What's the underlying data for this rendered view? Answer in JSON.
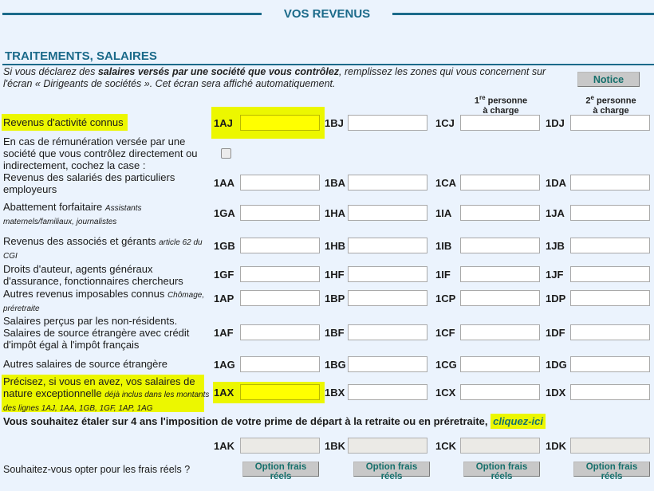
{
  "page": {
    "title": "VOS REVENUS",
    "section_title": "TRAITEMENTS, SALAIRES",
    "intro": {
      "part1": "Si vous déclarez des ",
      "bold": "salaires versés par une société que vous contrôlez",
      "part2": ", remplissez les zones qui vous concernent sur l'écran « Dirigeants de sociétés ». Cet écran sera affiché automatiquement."
    },
    "notice_button": "Notice",
    "colors": {
      "accent": "#1b6a8a",
      "highlight": "#ecf700",
      "button_text": "#16706c"
    }
  },
  "columns": {
    "col3_head": {
      "n": "1",
      "sup": "re",
      "rest": " personne",
      "line2": "à charge"
    },
    "col4_head": {
      "n": "2",
      "sup": "e",
      "rest": " personne",
      "line2": "à charge"
    }
  },
  "rows": [
    {
      "label": "Revenus d'activité connus",
      "hint": "",
      "codes": [
        "1AJ",
        "1BJ",
        "1CJ",
        "1DJ"
      ]
    },
    {
      "label": "En cas de rémunération versée par une société que vous contrôlez directement ou indirectement, cochez la case :",
      "checkbox_checked": false
    },
    {
      "label": "Revenus des salariés des particuliers employeurs",
      "hint": "",
      "codes": [
        "1AA",
        "1BA",
        "1CA",
        "1DA"
      ]
    },
    {
      "label": "Abattement forfaitaire ",
      "hint": "Assistants maternels/familiaux, journalistes",
      "codes": [
        "1GA",
        "1HA",
        "1IA",
        "1JA"
      ]
    },
    {
      "label": "Revenus des associés et gérants ",
      "hint": "article 62 du CGI",
      "codes": [
        "1GB",
        "1HB",
        "1IB",
        "1JB"
      ]
    },
    {
      "label": "Droits d'auteur, agents généraux d'assurance, fonctionnaires chercheurs",
      "hint": "",
      "codes": [
        "1GF",
        "1HF",
        "1IF",
        "1JF"
      ]
    },
    {
      "label": "Autres revenus imposables connus ",
      "hint": "Chômage, préretraite",
      "codes": [
        "1AP",
        "1BP",
        "1CP",
        "1DP"
      ]
    },
    {
      "label": "Salaires perçus par les non-résidents. Salaires de source étrangère avec crédit d'impôt égal à l'impôt français",
      "hint": "",
      "codes": [
        "1AF",
        "1BF",
        "1CF",
        "1DF"
      ]
    },
    {
      "label": "Autres salaires de source étrangère",
      "hint": "",
      "codes": [
        "1AG",
        "1BG",
        "1CG",
        "1DG"
      ]
    },
    {
      "label": "Précisez, si vous en avez, vos salaires de nature exceptionnelle ",
      "hint": "déjà inclus dans les montants des lignes 1AJ, 1AA, 1GB, 1GF, 1AP, 1AG",
      "codes": [
        "1AX",
        "1BX",
        "1CX",
        "1DX"
      ]
    }
  ],
  "retraite": {
    "text": "Vous souhaitez étaler sur 4 ans l'imposition de votre prime de départ à la retraite ou en préretraite, ",
    "link": "cliquez-ici",
    "codes": [
      "1AK",
      "1BK",
      "1CK",
      "1DK"
    ]
  },
  "frais_reels": {
    "question": "Souhaitez-vous opter pour les frais réels ?",
    "button_label": "Option frais réels"
  }
}
